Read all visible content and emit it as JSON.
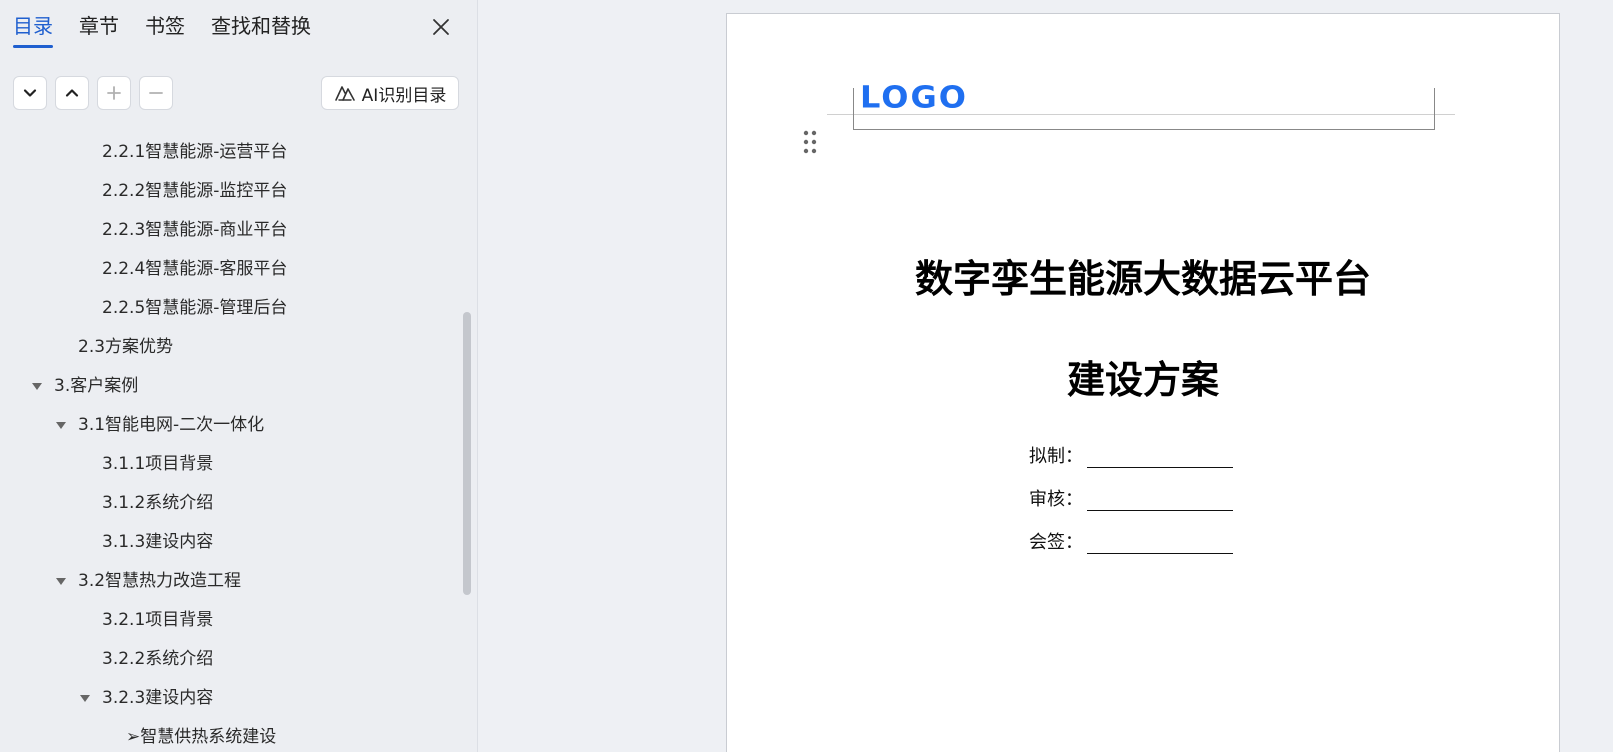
{
  "sidebar": {
    "tabs": [
      {
        "label": "目录",
        "active": true
      },
      {
        "label": "章节",
        "active": false
      },
      {
        "label": "书签",
        "active": false
      },
      {
        "label": "查找和替换",
        "active": false
      }
    ],
    "ai_button_label": "AI识别目录",
    "toc": [
      {
        "label": "2.2.1智慧能源-运营平台"
      },
      {
        "label": "2.2.2智慧能源-监控平台"
      },
      {
        "label": "2.2.3智慧能源-商业平台"
      },
      {
        "label": "2.2.4智慧能源-客服平台"
      },
      {
        "label": "2.2.5智慧能源-管理后台"
      },
      {
        "label": "2.3方案优势"
      },
      {
        "label": "3.客户案例"
      },
      {
        "label": "3.1智能电网-二次一体化"
      },
      {
        "label": "3.1.1项目背景"
      },
      {
        "label": "3.1.2系统介绍"
      },
      {
        "label": "3.1.3建设内容"
      },
      {
        "label": "3.2智慧热力改造工程"
      },
      {
        "label": "3.2.1项目背景"
      },
      {
        "label": "3.2.2系统介绍"
      },
      {
        "label": "3.2.3建设内容"
      },
      {
        "label": "➢智慧供热系统建设"
      }
    ]
  },
  "document": {
    "logo_text": "LOGO",
    "logo_color": "#1f6ff0",
    "title_line1": "数字孪生能源大数据云平台",
    "title_line2": "建设方案",
    "signatures": [
      {
        "label": "拟制："
      },
      {
        "label": "审核："
      },
      {
        "label": "会签："
      }
    ]
  }
}
